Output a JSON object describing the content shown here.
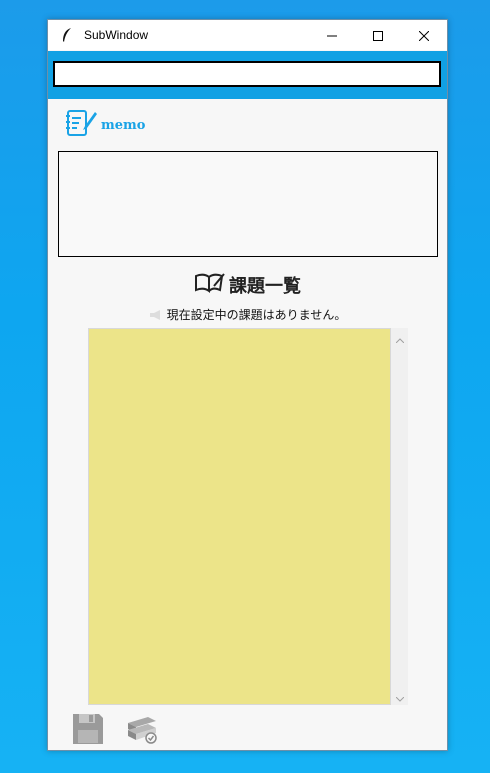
{
  "window": {
    "title": "SubWindow",
    "icons": {
      "app": "feather-icon",
      "minimize": "minimize-icon",
      "maximize": "maximize-icon",
      "close": "close-icon"
    }
  },
  "search": {
    "value": "",
    "placeholder": ""
  },
  "memo": {
    "label": "memo",
    "icon": "memo-edit-icon",
    "value": ""
  },
  "tasks": {
    "title": "課題一覧",
    "icon": "open-book-icon",
    "status_text": "現在設定中の課題はありません。",
    "status_icon": "megaphone-icon",
    "items": []
  },
  "toolbar": {
    "save_icon": "floppy-disk-icon",
    "books_icon": "books-check-icon"
  },
  "colors": {
    "accent": "#11a1e4",
    "list_bg": "#ece489",
    "desktop": "#0ea6f0"
  }
}
